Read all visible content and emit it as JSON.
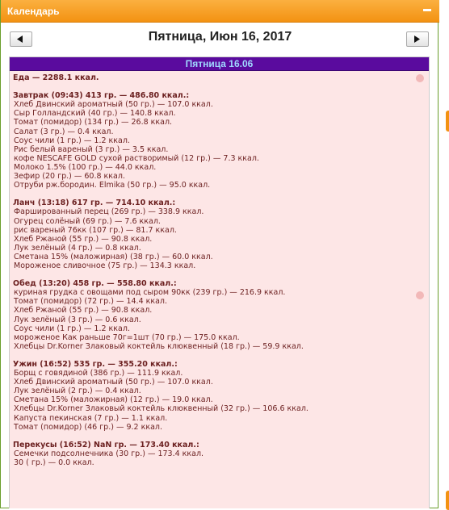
{
  "window": {
    "title": "Календарь"
  },
  "nav": {
    "date_title": "Пятница, Июн 16, 2017"
  },
  "day_header": "Пятница 16.06",
  "total_line": "Еда — 2288.1 ккал.",
  "meals": [
    {
      "header": "Завтрак (09:43) 413 гр. — 486.80 ккал.:",
      "items": [
        "Хлеб Двинский ароматный (50 гр.) — 107.0 ккал.",
        "Сыр Голландский (40 гр.) — 140.8 ккал.",
        "Томат (помидор) (134 гр.) — 26.8 ккал.",
        "Салат (3 гр.) — 0.4 ккал.",
        "Соус чили (1 гр.) — 1.2 ккал.",
        "Рис белый вареный (3 гр.) — 3.5 ккал.",
        "кофе NESCAFE GOLD сухой растворимый (12 гр.) — 7.3 ккал.",
        "Молоко 1.5% (100 гр.) — 44.0 ккал.",
        "Зефир (20 гр.) — 60.8 ккал.",
        "Отруби рж.бородин. Elmika (50 гр.) — 95.0 ккал."
      ]
    },
    {
      "header": "Ланч (13:18) 617 гр. — 714.10 ккал.:",
      "items": [
        "Фаршированный перец (269 гр.) — 338.9 ккал.",
        "Огурец солёный (69 гр.) — 7.6 ккал.",
        "рис вареный 76кк (107 гр.) — 81.7 ккал.",
        "Хлеб Ржаной (55 гр.) — 90.8 ккал.",
        "Лук зелёный (4 гр.) — 0.8 ккал.",
        "Сметана 15% (маложирная) (38 гр.) — 60.0 ккал.",
        "Мороженое сливочное (75 гр.) — 134.3 ккал."
      ]
    },
    {
      "header": "Обед (13:20) 458 гр. — 558.80 ккал.:",
      "items": [
        "куриная грудка с овощами под сыром 90кк (239 гр.) — 216.9 ккал.",
        "Томат (помидор) (72 гр.) — 14.4 ккал.",
        "Хлеб Ржаной (55 гр.) — 90.8 ккал.",
        "Лук зелёный (3 гр.) — 0.6 ккал.",
        "Соус чили (1 гр.) — 1.2 ккал.",
        "мороженое Как раньше 70г=1шт (70 гр.) — 175.0 ккал.",
        "Хлебцы Dr.Korner Злаковый коктейль клюквенный (18 гр.) — 59.9 ккал."
      ]
    },
    {
      "header": "Ужин (16:52) 535 гр. — 355.20 ккал.:",
      "items": [
        "Борщ с говядиной (386 гр.) — 111.9 ккал.",
        "Хлеб Двинский ароматный (50 гр.) — 107.0 ккал.",
        "Лук зелёный (2 гр.) — 0.4 ккал.",
        "Сметана 15% (маложирная) (12 гр.) — 19.0 ккал.",
        "Хлебцы Dr.Korner Злаковый коктейль клюквенный (32 гр.) — 106.6 ккал.",
        "Капуста пекинская (7 гр.) — 1.1 ккал.",
        "Томат (помидор) (46 гр.) — 9.2 ккал."
      ]
    },
    {
      "header": "Перекусы (16:52) NaN гр. — 173.40 ккал.:",
      "items": [
        "Семечки подсолнечника (30 гр.) — 173.4 ккал.",
        "30 ( гр.) — 0.0 ккал."
      ]
    }
  ],
  "icons": {
    "minimize": "minimize-icon",
    "prev": "triangle-left-icon",
    "next": "triangle-right-icon"
  },
  "colors": {
    "titlebar": "#f39212",
    "day_header_bg": "#5a0b9e",
    "day_header_text": "#9fd8ff",
    "content_bg": "#fde6e6",
    "text": "#6b1f1f"
  }
}
